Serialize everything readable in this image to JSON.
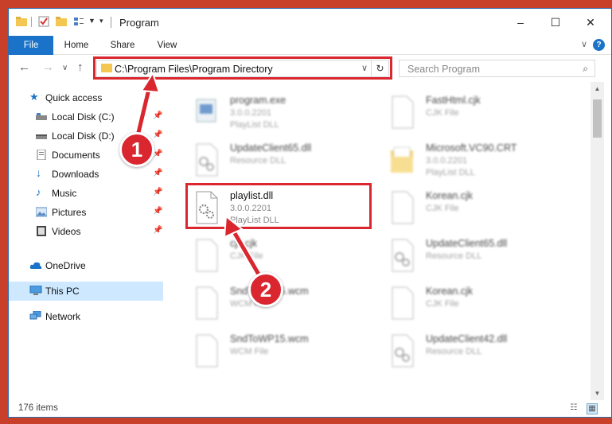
{
  "window": {
    "title": "Program",
    "controls": {
      "minimize": "–",
      "maximize": "☐",
      "close": "✕"
    }
  },
  "ribbon": {
    "tabs": [
      "File",
      "Home",
      "Share",
      "View"
    ],
    "help": "?"
  },
  "address": {
    "path": "C:\\Program Files\\Program Directory",
    "dropdown": "∨",
    "refresh": "↻"
  },
  "search": {
    "placeholder": "Search Program"
  },
  "sidebar": {
    "items": [
      {
        "label": "Quick access",
        "icon": "star-icon",
        "pinned": false
      },
      {
        "label": "Local Disk (C:)",
        "icon": "drive-icon",
        "pinned": true
      },
      {
        "label": "Local Disk (D:)",
        "icon": "drive-icon",
        "pinned": true
      },
      {
        "label": "Documents",
        "icon": "documents-icon",
        "pinned": true
      },
      {
        "label": "Downloads",
        "icon": "download-icon",
        "pinned": true
      },
      {
        "label": "Music",
        "icon": "music-icon",
        "pinned": true
      },
      {
        "label": "Pictures",
        "icon": "pictures-icon",
        "pinned": true
      },
      {
        "label": "Videos",
        "icon": "videos-icon",
        "pinned": true
      },
      {
        "label": "OneDrive",
        "icon": "cloud-icon",
        "pinned": false
      },
      {
        "label": "This PC",
        "icon": "computer-icon",
        "pinned": false,
        "selected": true
      },
      {
        "label": "Network",
        "icon": "network-icon",
        "pinned": false
      }
    ]
  },
  "files": [
    {
      "name": "program.exe",
      "version": "3.0.0.2201",
      "type": "PlayList DLL",
      "blurred": true
    },
    {
      "name": "FastHtml.cjk",
      "version": "",
      "type": "CJK File",
      "blurred": true
    },
    {
      "name": "UpdateClient65.dll",
      "version": "",
      "type": "Resource DLL",
      "blurred": true
    },
    {
      "name": "Microsoft.VC90.CRT",
      "version": "3.0.0.2201",
      "type": "PlayList DLL",
      "blurred": true
    },
    {
      "name": "playlist.dll",
      "version": "3.0.0.2201",
      "type": "PlayList DLL",
      "blurred": false
    },
    {
      "name": "Korean.cjk",
      "version": "",
      "type": "CJK File",
      "blurred": true
    },
    {
      "name": "cjk.cjk",
      "version": "",
      "type": "CJK File",
      "blurred": true
    },
    {
      "name": "UpdateClient65.dll",
      "version": "",
      "type": "Resource DLL",
      "blurred": true
    },
    {
      "name": "SndToWP15.wcm",
      "version": "",
      "type": "WCM File",
      "blurred": true
    },
    {
      "name": "Korean.cjk",
      "version": "",
      "type": "CJK File",
      "blurred": true
    },
    {
      "name": "SndToWP15.wcm",
      "version": "",
      "type": "WCM File",
      "blurred": true
    },
    {
      "name": "UpdateClient42.dll",
      "version": "",
      "type": "Resource DLL",
      "blurred": true
    }
  ],
  "status": {
    "item_count": "176 items"
  },
  "annotations": {
    "step1": "1",
    "step2": "2",
    "color": "#d9262f"
  }
}
